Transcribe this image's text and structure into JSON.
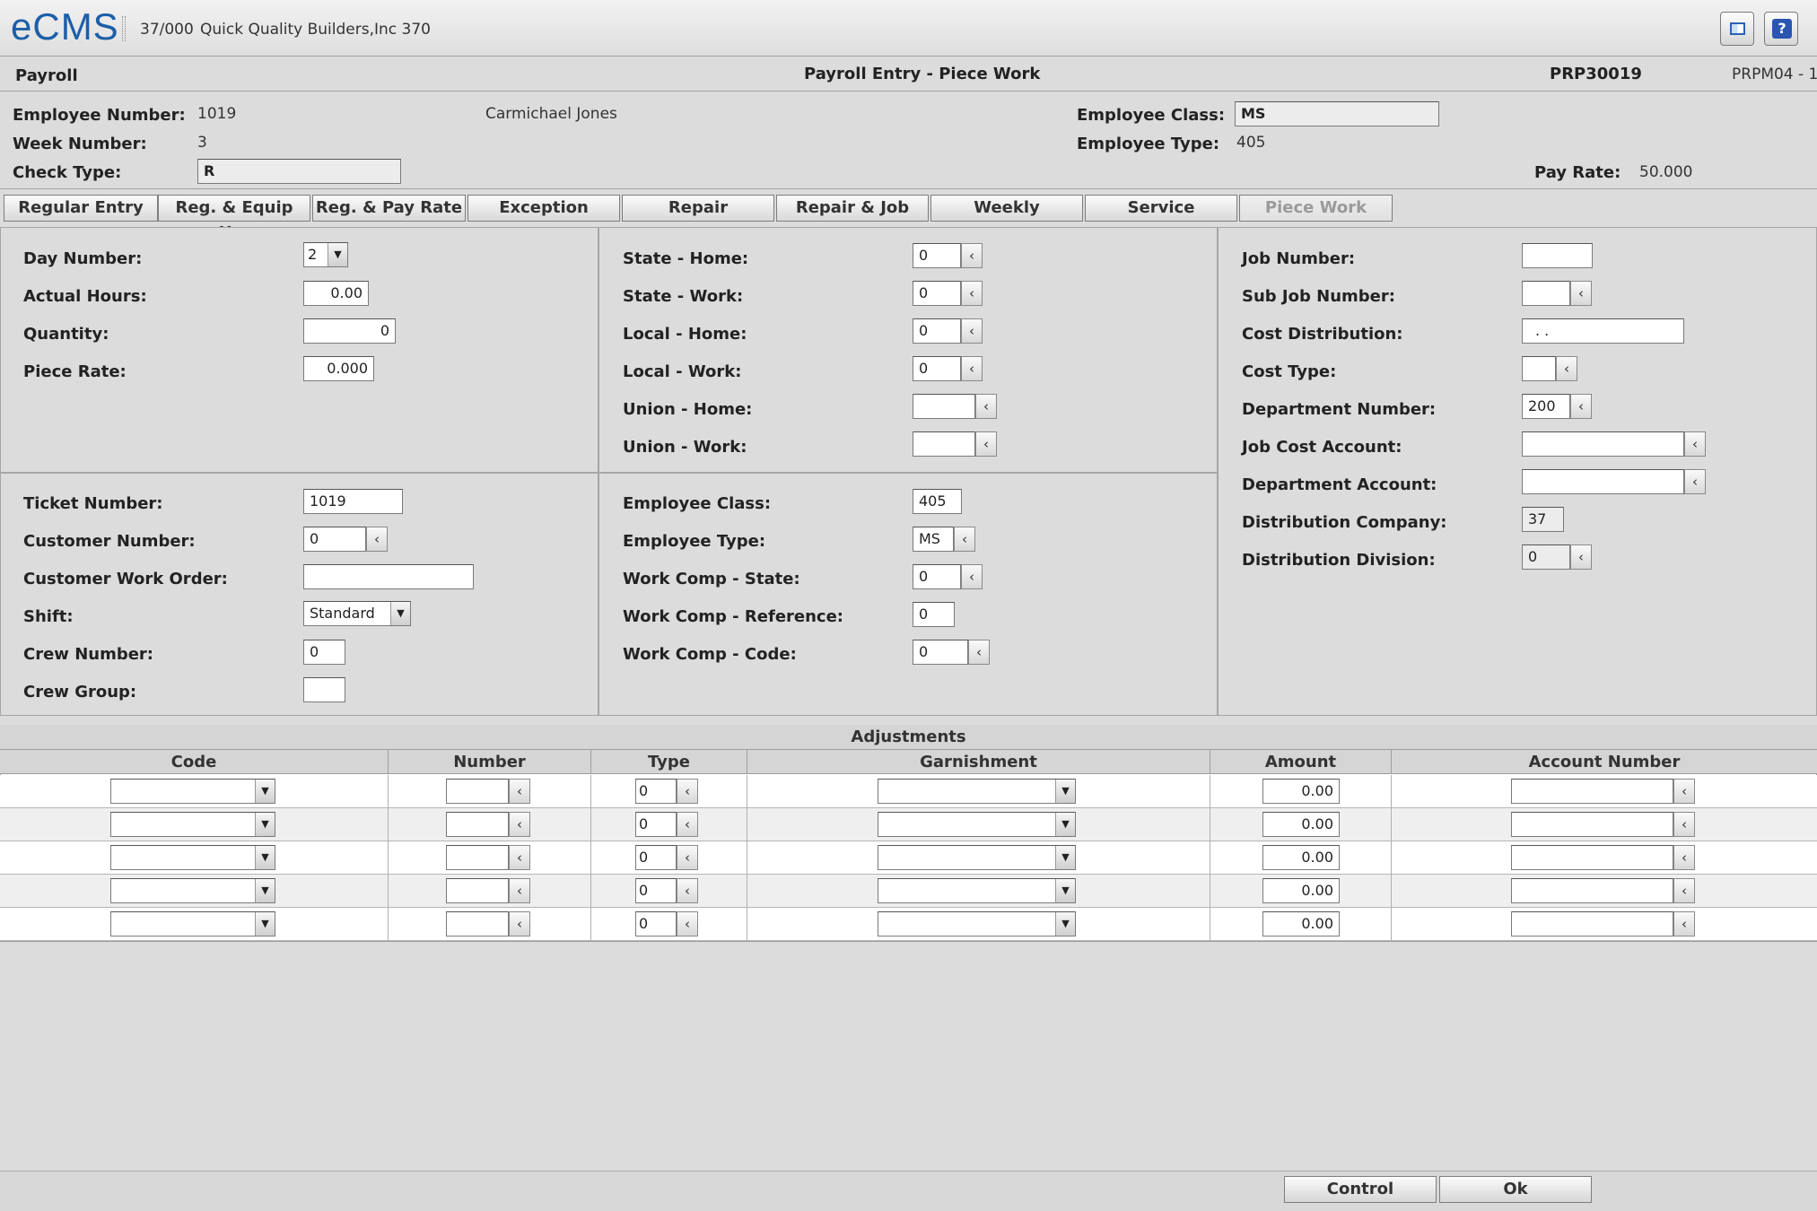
{
  "app": {
    "logo": "eCMS",
    "company_code": "37/000",
    "company_name": "Quick Quality Builders,Inc 370"
  },
  "header": {
    "module": "Payroll",
    "title": "Payroll Entry - Piece Work",
    "program": "PRP30019",
    "screen_id": "PRPM04 - 1"
  },
  "employee": {
    "number_label": "Employee Number:",
    "number": "1019",
    "name": "Carmichael Jones",
    "week_label": "Week Number:",
    "week": "3",
    "check_type_label": "Check Type:",
    "check_type": "R",
    "class_label": "Employee Class:",
    "class": "MS",
    "type_label": "Employee Type:",
    "type": "405",
    "pay_rate_label": "Pay Rate:",
    "pay_rate": "50.000"
  },
  "tabs": [
    {
      "label": "Regular Entry"
    },
    {
      "label": "Reg. & Equip Hrs"
    },
    {
      "label": "Reg. & Pay Rate"
    },
    {
      "label": "Exception"
    },
    {
      "label": "Repair"
    },
    {
      "label": "Repair & Job"
    },
    {
      "label": "Weekly"
    },
    {
      "label": "Service"
    },
    {
      "label": "Piece Work"
    }
  ],
  "panel1": {
    "day_label": "Day Number:",
    "day": "2",
    "hours_label": "Actual Hours:",
    "hours": "0.00",
    "qty_label": "Quantity:",
    "qty": "0",
    "rate_label": "Piece Rate:",
    "rate": "0.000"
  },
  "panel2": {
    "state_home_label": "State - Home:",
    "state_home": "0",
    "state_work_label": "State - Work:",
    "state_work": "0",
    "local_home_label": "Local - Home:",
    "local_home": "0",
    "local_work_label": "Local - Work:",
    "local_work": "0",
    "union_home_label": "Union - Home:",
    "union_home": "",
    "union_work_label": "Union - Work:",
    "union_work": ""
  },
  "panel3": {
    "job_label": "Job Number:",
    "job": "",
    "subjob_label": "Sub Job Number:",
    "subjob": "",
    "cost_dist_label": "Cost Distribution:",
    "cost_dist": " .    .",
    "cost_type_label": "Cost Type:",
    "cost_type": "",
    "dept_label": "Department Number:",
    "dept": "200",
    "jca_label": "Job Cost Account:",
    "jca": "",
    "dept_acct_label": "Department Account:",
    "dept_acct": "",
    "dist_co_label": "Distribution Company:",
    "dist_co": "37",
    "dist_div_label": "Distribution Division:",
    "dist_div": "0"
  },
  "panel4": {
    "ticket_label": "Ticket Number:",
    "ticket": "1019",
    "customer_label": "Customer Number:",
    "customer": "0",
    "cwo_label": "Customer Work Order:",
    "cwo": "",
    "shift_label": "Shift:",
    "shift": "Standard",
    "crew_label": "Crew Number:",
    "crew": "0",
    "crew_group_label": "Crew Group:",
    "crew_group": ""
  },
  "panel5": {
    "class_label": "Employee Class:",
    "class": "405",
    "type_label": "Employee Type:",
    "type": "MS",
    "wc_state_label": "Work Comp - State:",
    "wc_state": "0",
    "wc_ref_label": "Work Comp - Reference:",
    "wc_ref": "0",
    "wc_code_label": "Work Comp - Code:",
    "wc_code": "0"
  },
  "adjustments": {
    "title": "Adjustments",
    "columns": [
      "Code",
      "Number",
      "Type",
      "Garnishment",
      "Amount",
      "Account Number"
    ],
    "rows": [
      {
        "type": "0",
        "amount": "0.00"
      },
      {
        "type": "0",
        "amount": "0.00"
      },
      {
        "type": "0",
        "amount": "0.00"
      },
      {
        "type": "0",
        "amount": "0.00"
      },
      {
        "type": "0",
        "amount": "0.00"
      }
    ]
  },
  "footer": {
    "control": "Control",
    "ok": "Ok"
  },
  "colors": {
    "background": "#dcdcdc",
    "logo_blue": "#1c5fa8",
    "help_button": "#2a55b0"
  },
  "icons": {
    "layout": "window-layout-icon",
    "help": "help-icon",
    "lookup": "chevron-left-icon",
    "dropdown": "dropdown-arrow-icon"
  }
}
